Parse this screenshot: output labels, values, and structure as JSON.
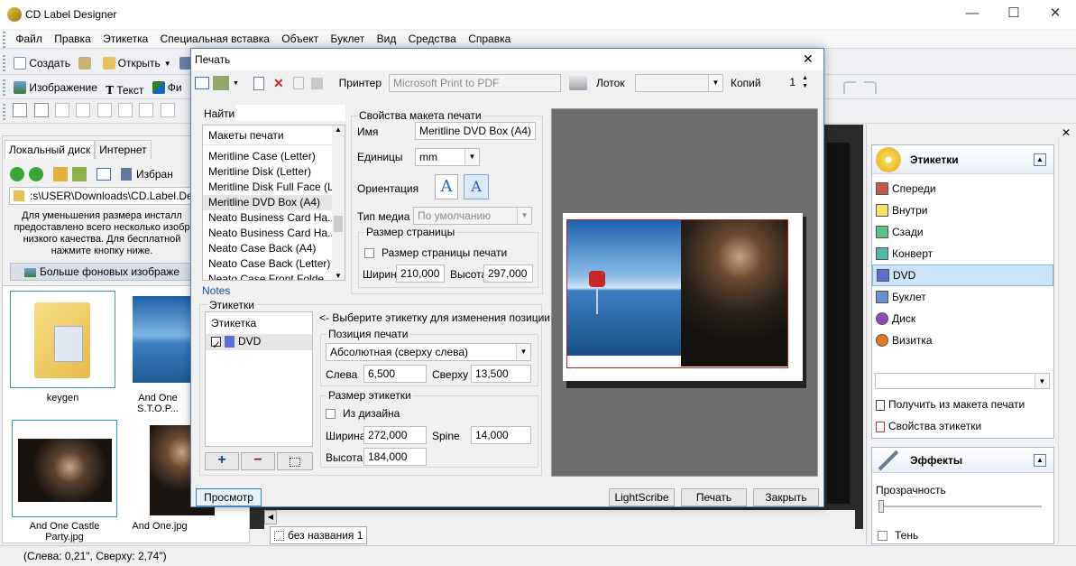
{
  "app": {
    "title": "CD Label Designer"
  },
  "window_controls": {
    "min": "—",
    "max": "☐",
    "close": "✕"
  },
  "menu": [
    "Файл",
    "Правка",
    "Этикетка",
    "Специальная вставка",
    "Объект",
    "Буклет",
    "Вид",
    "Средства",
    "Справка"
  ],
  "toolbar1": {
    "create": "Создать",
    "open": "Открыть"
  },
  "toolbar2": {
    "image": "Изображение",
    "text": "Текст",
    "shape_partial": "Фи"
  },
  "leftpanel": {
    "tabs": [
      "Локальный диск",
      "Интернет"
    ],
    "favorites": "Избран",
    "path": ":s\\USER\\Downloads\\CD.Label.Designer",
    "info": "Для уменьшения размера инсталл предоставлено всего несколько изобр низкого качества. Для бесплатной нажмите кнопку ниже.",
    "more_backgrounds": "Больше фоновых изображе",
    "thumbs": [
      {
        "label": "keygen"
      },
      {
        "label": "And One S.T.O.P..."
      },
      {
        "label": "And One Castle Party.jpg"
      },
      {
        "label": "And One.jpg"
      }
    ]
  },
  "rightpanel": {
    "labels_title": "Этикетки",
    "items": [
      {
        "label": "Спереди",
        "color": "#c8584a"
      },
      {
        "label": "Внутри",
        "color": "#f5e36a"
      },
      {
        "label": "Сзади",
        "color": "#5bc48e"
      },
      {
        "label": "Конверт",
        "color": "#50b8a8"
      },
      {
        "label": "DVD",
        "color": "#5a6fd0"
      },
      {
        "label": "Буклет",
        "color": "#6a8fd0"
      },
      {
        "label": "Диск",
        "color": "#8b4bb8"
      },
      {
        "label": "Визитка",
        "color": "#e07a2a"
      }
    ],
    "get_from_layout": "Получить из макета печати",
    "label_props": "Свойства этикетки",
    "effects_title": "Эффекты",
    "transparency": "Прозрачность",
    "shadow": "Тень"
  },
  "canvas": {
    "tab_label": "без названия 1"
  },
  "status": {
    "text": "(Слева: 0,21\", Сверху: 2,74\")"
  },
  "dialog": {
    "title": "Печать",
    "printer_label": "Принтер",
    "printer_value": "Microsoft Print to PDF",
    "tray_label": "Лоток",
    "copies_label": "Копий",
    "copies_value": "1",
    "find_label": "Найти",
    "layouts_header": "Макеты печати",
    "layouts": [
      "Meritline Case (Letter)",
      "Meritline Disk (Letter)",
      "Meritline Disk Full Face (L...",
      "Meritline DVD Box (A4)",
      "Neato Business Card Ha...",
      "Neato Business Card Ha...",
      "Neato Case Back (A4)",
      "Neato Case Back (Letter)",
      "Neato Case Front Folde..."
    ],
    "notes": "Notes",
    "layout_props": "Свойства макета печати",
    "name_label": "Имя",
    "name_value": "Meritline DVD Box (A4)",
    "units_label": "Единицы",
    "units_value": "mm",
    "orientation_label": "Ориентация",
    "media_label": "Тип медиа",
    "media_value": "По умолчанию",
    "page_size_title": "Размер страницы",
    "page_size_chk": "Размер страницы печати",
    "width_label": "Ширина",
    "width_value": "210,000",
    "height_label": "Высота",
    "height_value": "297,000",
    "labels_group": "Этикетки",
    "labels_header": "Этикетка",
    "label_item": "DVD",
    "select_hint": "<- Выберите этикетку для изменения позиции",
    "print_pos_title": "Позиция печати",
    "print_pos_value": "Абсолютная (сверху слева)",
    "left_label": "Слева",
    "left_value": "6,500",
    "top_label": "Сверху",
    "top_value": "13,500",
    "label_size_title": "Размер этикетки",
    "from_design": "Из дизайна",
    "lw_label": "Ширина",
    "lw_value": "272,000",
    "spine_label": "Spine",
    "spine_value": "14,000",
    "lh_label": "Высота",
    "lh_value": "184,000",
    "btn_preview": "Просмотр",
    "btn_lightscribe": "LightScribe",
    "btn_print": "Печать",
    "btn_close": "Закрыть",
    "close_x": "✕"
  }
}
